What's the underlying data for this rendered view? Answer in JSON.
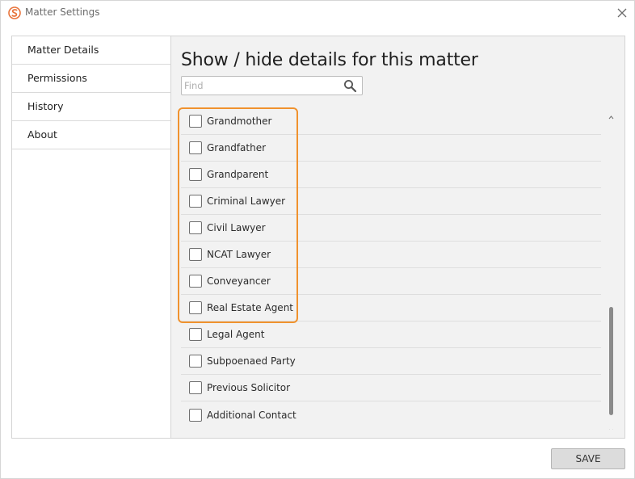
{
  "window": {
    "title": "Matter Settings",
    "app_icon": "smokeball-logo-icon",
    "close_icon": "close-icon"
  },
  "sidebar": {
    "items": [
      {
        "label": "Matter Details",
        "selected": true
      },
      {
        "label": "Permissions",
        "selected": false
      },
      {
        "label": "History",
        "selected": false
      },
      {
        "label": "About",
        "selected": false
      }
    ]
  },
  "main": {
    "heading": "Show / hide details for this matter",
    "search": {
      "placeholder": "Find",
      "value": "",
      "icon": "search-icon"
    },
    "items": [
      {
        "label": "Grandmother",
        "checked": false
      },
      {
        "label": "Grandfather",
        "checked": false
      },
      {
        "label": "Grandparent",
        "checked": false
      },
      {
        "label": "Criminal Lawyer",
        "checked": false
      },
      {
        "label": "Civil Lawyer",
        "checked": false
      },
      {
        "label": "NCAT Lawyer",
        "checked": false
      },
      {
        "label": "Conveyancer",
        "checked": false
      },
      {
        "label": "Real Estate Agent",
        "checked": false
      },
      {
        "label": "Legal Agent",
        "checked": false
      },
      {
        "label": "Subpoenaed Party",
        "checked": false
      },
      {
        "label": "Previous Solicitor",
        "checked": false
      },
      {
        "label": "Additional Contact",
        "checked": false
      }
    ]
  },
  "footer": {
    "save_label": "SAVE"
  },
  "colors": {
    "highlight": "#f0922e",
    "panel_bg": "#f2f2f2",
    "logo": "#e8743b"
  }
}
